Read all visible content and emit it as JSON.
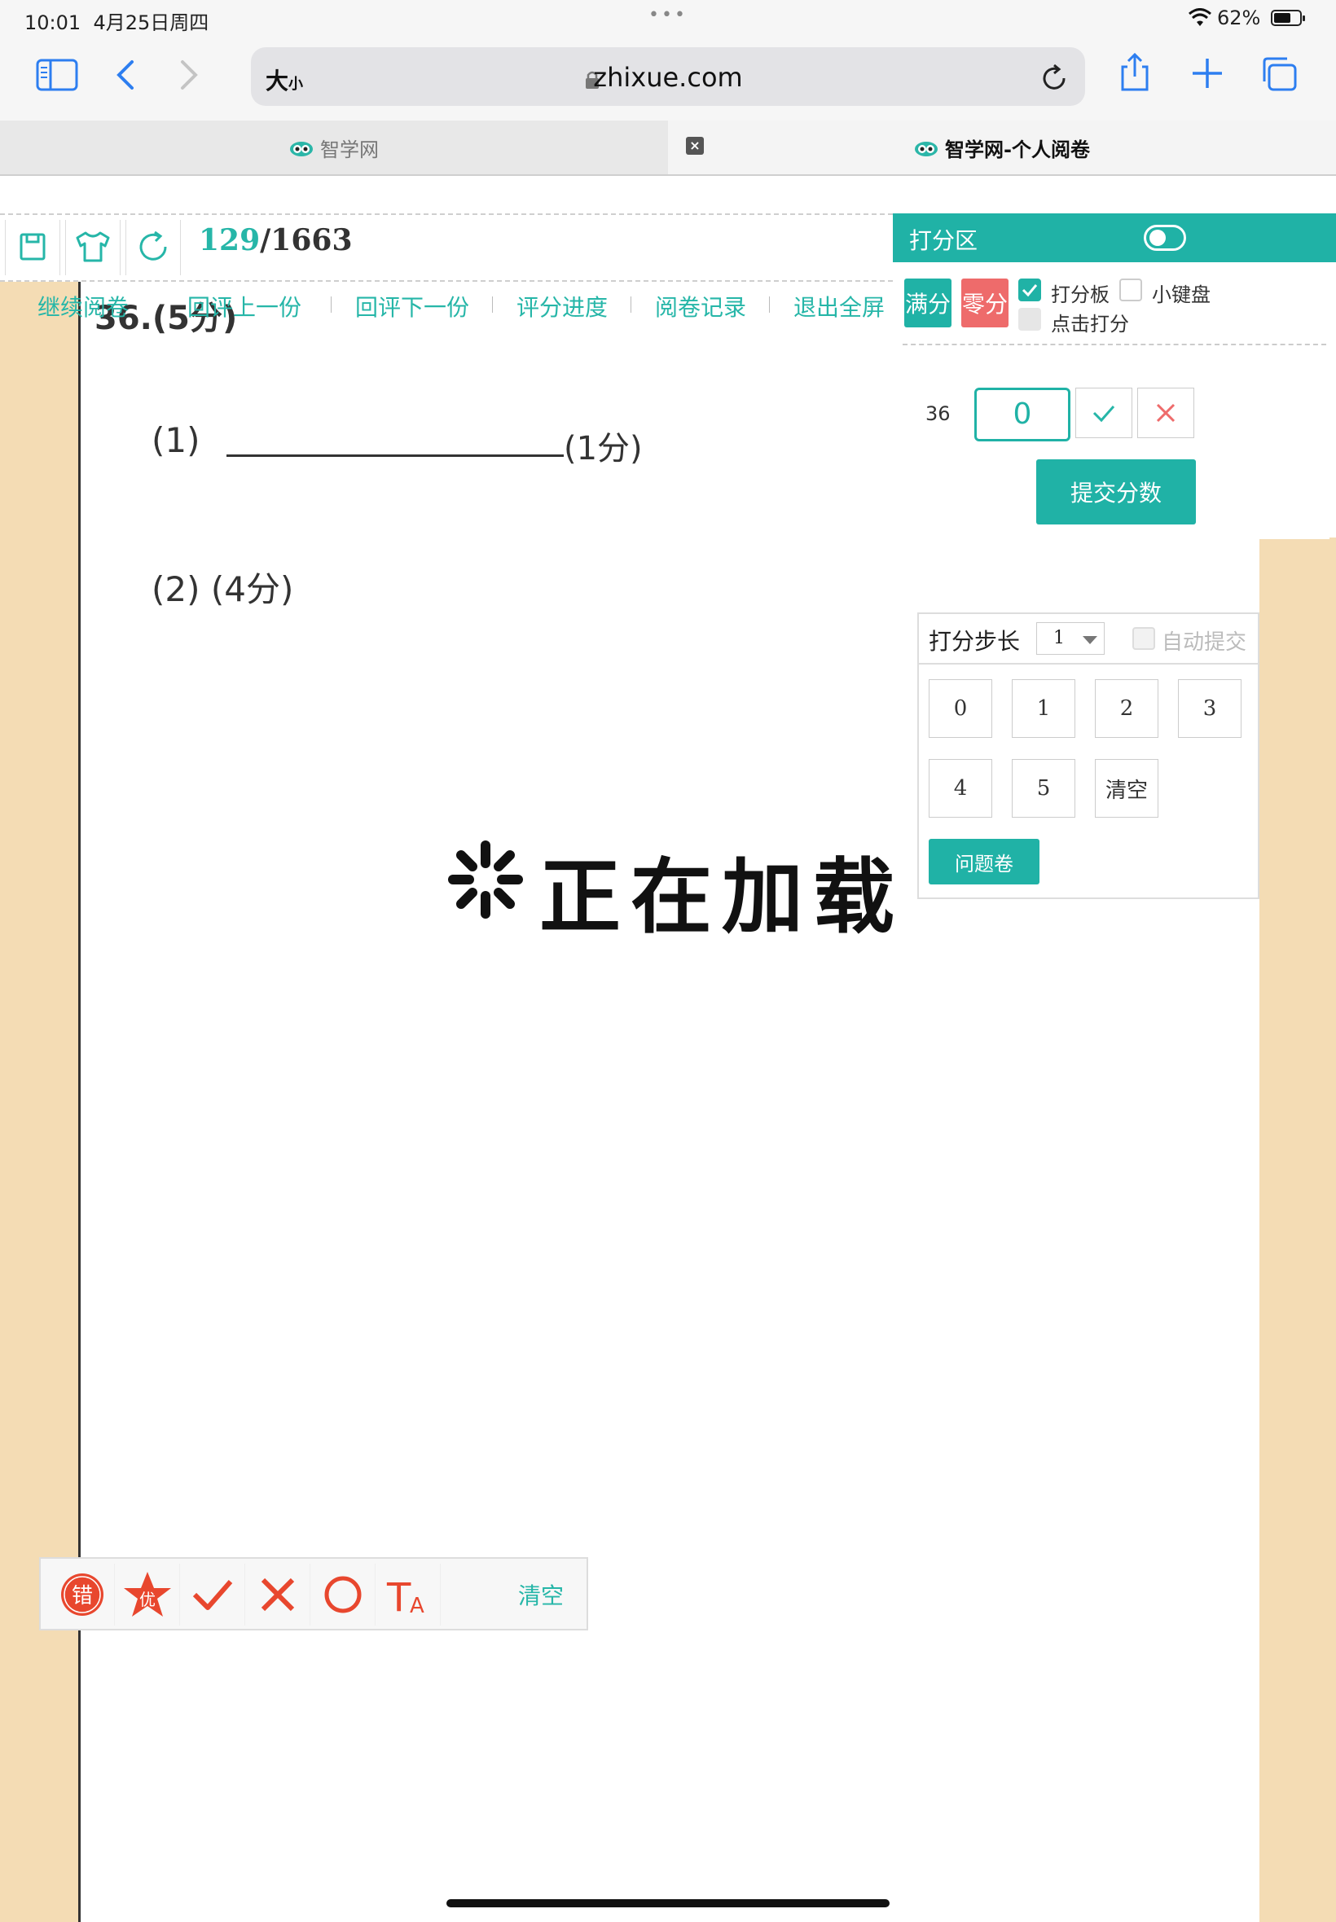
{
  "status_bar": {
    "time": "10:01",
    "date": "4月25日周四",
    "battery": "62%",
    "dots": "•••"
  },
  "browser": {
    "address_size_big": "大",
    "address_size_small": "小",
    "url": "zhixue.com",
    "icons": [
      "sidebar-icon",
      "back-icon",
      "forward-icon",
      "lock-icon",
      "reload-icon",
      "share-icon",
      "new-tab-icon",
      "tabs-icon"
    ]
  },
  "tabs": [
    {
      "label": "智学网",
      "active": false
    },
    {
      "label": "智学网-个人阅卷",
      "active": true
    }
  ],
  "progress": {
    "current": "129",
    "total": "/1663"
  },
  "nav_links": [
    "继续阅卷",
    "回评上一份",
    "回评下一份",
    "评分进度",
    "阅卷记录",
    "退出全屏"
  ],
  "question": {
    "title": "36.(5分)",
    "part1": "(1)",
    "part1_score": "(1分)",
    "part2": "(2) (4分)",
    "loading": "正在加载"
  },
  "score_panel": {
    "title": "打分区",
    "full_label": "满分",
    "zero_label": "零分",
    "score_board_label": "打分板",
    "keypad_label": "小键盘",
    "click_score_label": "点击打分",
    "question_number": "36",
    "score_value": "0",
    "submit_label": "提交分数"
  },
  "score_board": {
    "step_label": "打分步长",
    "step_value": "1",
    "auto_submit_label": "自动提交",
    "keys": [
      "0",
      "1",
      "2",
      "3",
      "4",
      "5",
      "清空"
    ],
    "problem_label": "问题卷"
  },
  "mark_tools": {
    "wrong_label": "错",
    "excellent_label": "优",
    "text_label": "T",
    "text_sub": "A",
    "clear_label": "清空"
  },
  "colors": {
    "accent": "#20b2a6",
    "danger": "#ee6b6b",
    "mark_red": "#e8472e",
    "paper_bg": "#f4dcb4",
    "ios_blue": "#2d7ef0"
  }
}
